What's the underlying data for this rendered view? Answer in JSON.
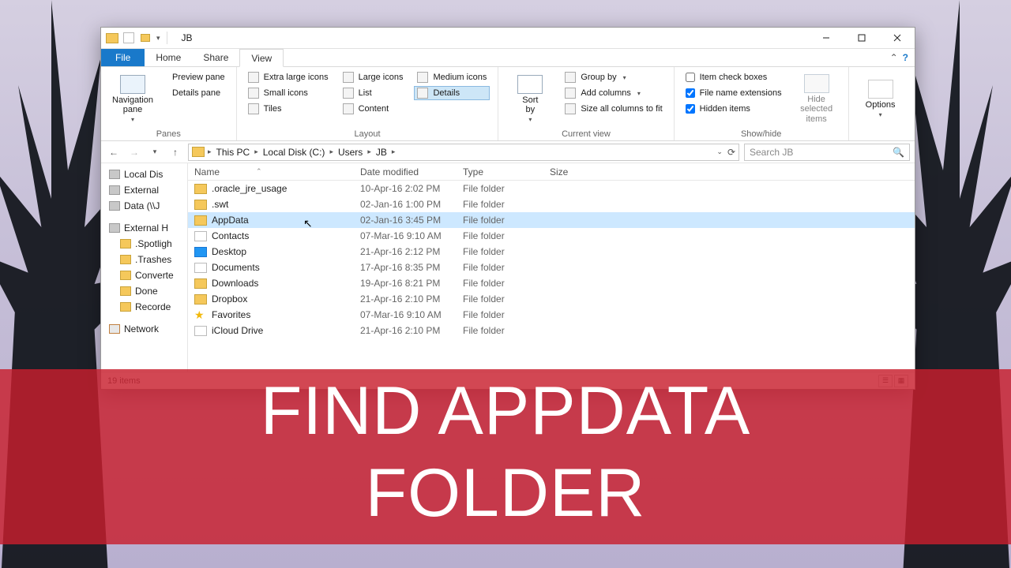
{
  "overlay": {
    "line1": "FIND APPDATA",
    "line2": "FOLDER"
  },
  "window": {
    "title": "JB",
    "menu": {
      "file": "File",
      "home": "Home",
      "share": "Share",
      "view": "View"
    },
    "ribbon": {
      "panes_group": "Panes",
      "nav_pane": "Navigation\npane",
      "preview_pane": "Preview pane",
      "details_pane": "Details pane",
      "layout_group": "Layout",
      "layout": {
        "xl": "Extra large icons",
        "lg": "Large icons",
        "md": "Medium icons",
        "sm": "Small icons",
        "list": "List",
        "details": "Details",
        "tiles": "Tiles",
        "content": "Content"
      },
      "current_view_group": "Current view",
      "sort_by": "Sort\nby",
      "group_by": "Group by",
      "add_columns": "Add columns",
      "size_all": "Size all columns to fit",
      "showhide_group": "Show/hide",
      "item_checkboxes": "Item check boxes",
      "file_ext": "File name extensions",
      "hidden_items": "Hidden items",
      "hide_selected": "Hide selected\nitems",
      "options": "Options"
    },
    "breadcrumb": [
      "This PC",
      "Local Disk (C:)",
      "Users",
      "JB"
    ],
    "search_placeholder": "Search JB",
    "columns": {
      "name": "Name",
      "date": "Date modified",
      "type": "Type",
      "size": "Size"
    },
    "nav_items": [
      {
        "label": "Local Dis",
        "kind": "drive",
        "child": false
      },
      {
        "label": "External",
        "kind": "drive",
        "child": false
      },
      {
        "label": "Data (\\\\J",
        "kind": "drive",
        "child": false
      },
      {
        "label": "",
        "kind": "gap",
        "child": false
      },
      {
        "label": "External H",
        "kind": "drive",
        "child": false
      },
      {
        "label": ".Spotligh",
        "kind": "folder",
        "child": true
      },
      {
        "label": ".Trashes",
        "kind": "folder",
        "child": true
      },
      {
        "label": "Converte",
        "kind": "folder",
        "child": true
      },
      {
        "label": "Done",
        "kind": "folder",
        "child": true
      },
      {
        "label": "Recorde",
        "kind": "folder",
        "child": true
      },
      {
        "label": "",
        "kind": "gap",
        "child": false
      },
      {
        "label": "Network",
        "kind": "net",
        "child": false
      }
    ],
    "files": [
      {
        "name": ".oracle_jre_usage",
        "date": "10-Apr-16 2:02 PM",
        "type": "File folder",
        "icon": "folder"
      },
      {
        "name": ".swt",
        "date": "02-Jan-16 1:00 PM",
        "type": "File folder",
        "icon": "folder"
      },
      {
        "name": "AppData",
        "date": "02-Jan-16 3:45 PM",
        "type": "File folder",
        "icon": "folder",
        "selected": true
      },
      {
        "name": "Contacts",
        "date": "07-Mar-16 9:10 AM",
        "type": "File folder",
        "icon": "doc"
      },
      {
        "name": "Desktop",
        "date": "21-Apr-16 2:12 PM",
        "type": "File folder",
        "icon": "blue"
      },
      {
        "name": "Documents",
        "date": "17-Apr-16 8:35 PM",
        "type": "File folder",
        "icon": "doc"
      },
      {
        "name": "Downloads",
        "date": "19-Apr-16 8:21 PM",
        "type": "File folder",
        "icon": "folder"
      },
      {
        "name": "Dropbox",
        "date": "21-Apr-16 2:10 PM",
        "type": "File folder",
        "icon": "folder"
      },
      {
        "name": "Favorites",
        "date": "07-Mar-16 9:10 AM",
        "type": "File folder",
        "icon": "star"
      },
      {
        "name": "iCloud Drive",
        "date": "21-Apr-16 2:10 PM",
        "type": "File folder",
        "icon": "cloud"
      }
    ],
    "status": "19 items",
    "checkboxes": {
      "item_checkboxes": false,
      "file_ext": true,
      "hidden_items": true
    }
  }
}
